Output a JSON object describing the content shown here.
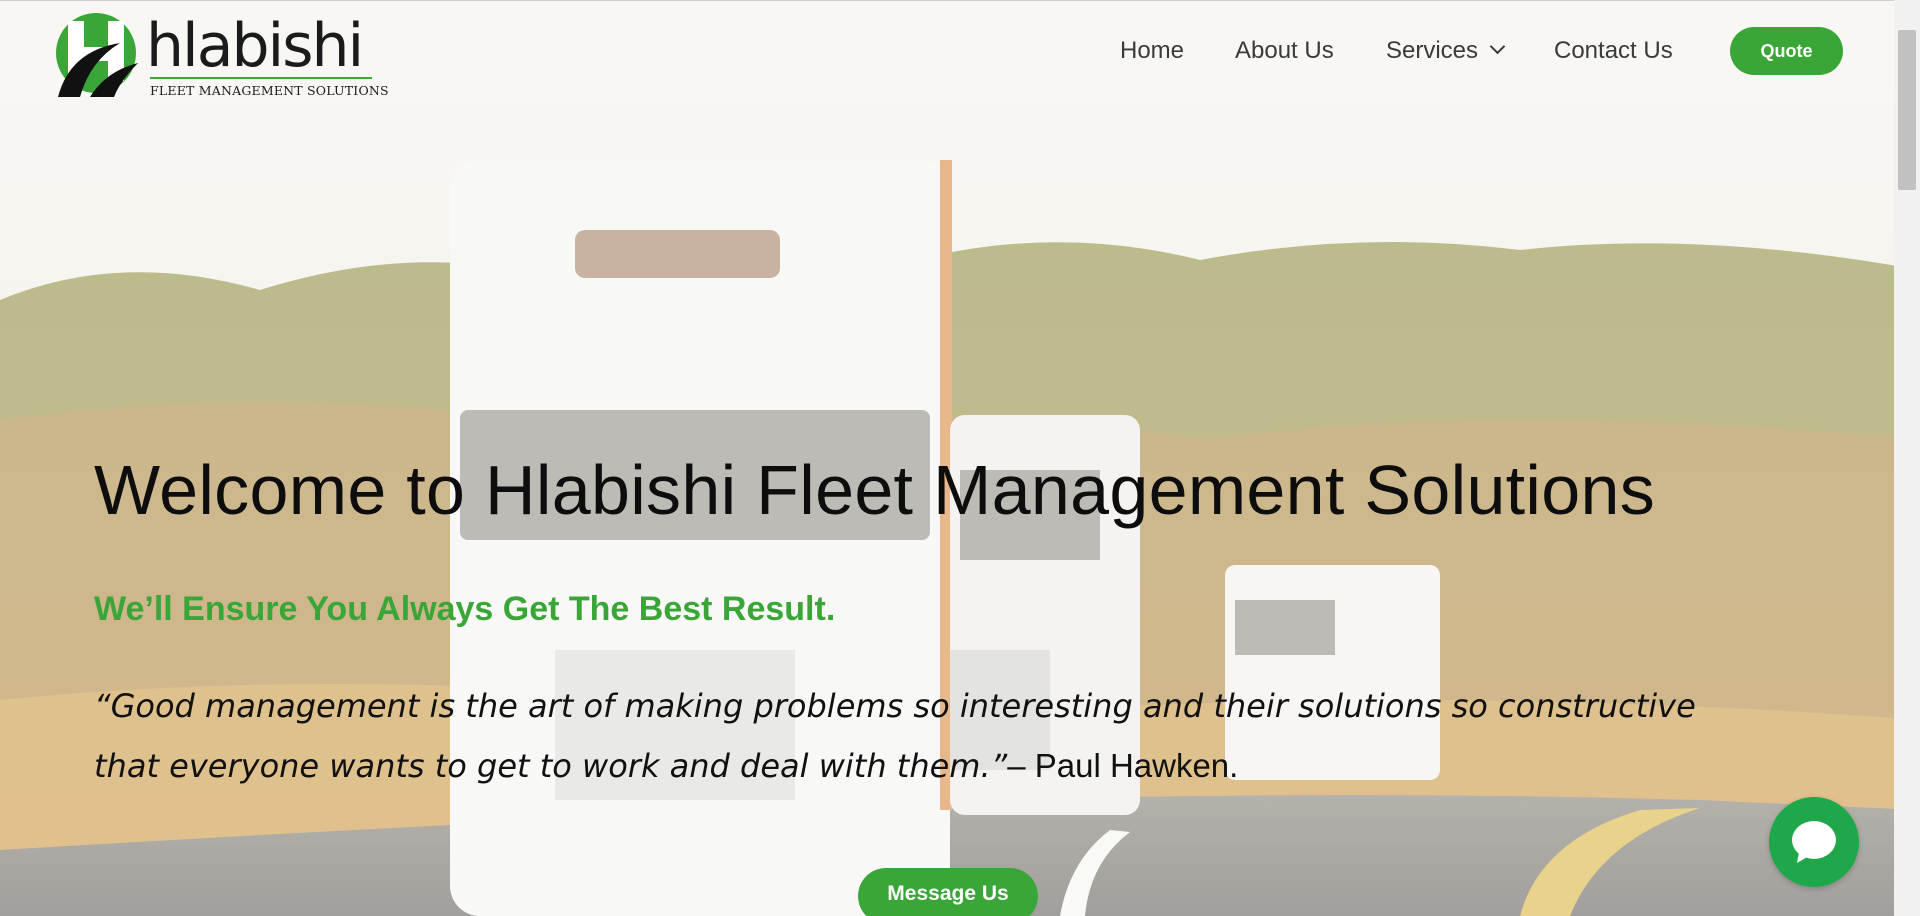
{
  "brand": {
    "wordmark": "hlabishi",
    "tagline": "FLEET MANAGEMENT SOLUTIONS",
    "color_primary": "#3aa637",
    "color_dark": "#1b1b1b"
  },
  "nav": {
    "items": [
      {
        "label": "Home"
      },
      {
        "label": "About Us"
      },
      {
        "label": "Services",
        "has_dropdown": true
      },
      {
        "label": "Contact Us"
      }
    ],
    "cta_label": "Quote"
  },
  "hero": {
    "title": "Welcome to Hlabishi Fleet Management Solutions",
    "subtitle": "We’ll Ensure You Always Get The Best Result.",
    "quote": "“Good management is the art of making problems so interesting and their solutions so constructive that everyone wants to get to work and deal with them.”",
    "quote_author": "– Paul Hawken.",
    "cta_label": "Message Us"
  },
  "chat_widget": {
    "icon": "chat-bubble-icon"
  },
  "icons": {
    "dropdown": "chevron-down-icon",
    "logo": "hlabishi-logo-icon"
  }
}
